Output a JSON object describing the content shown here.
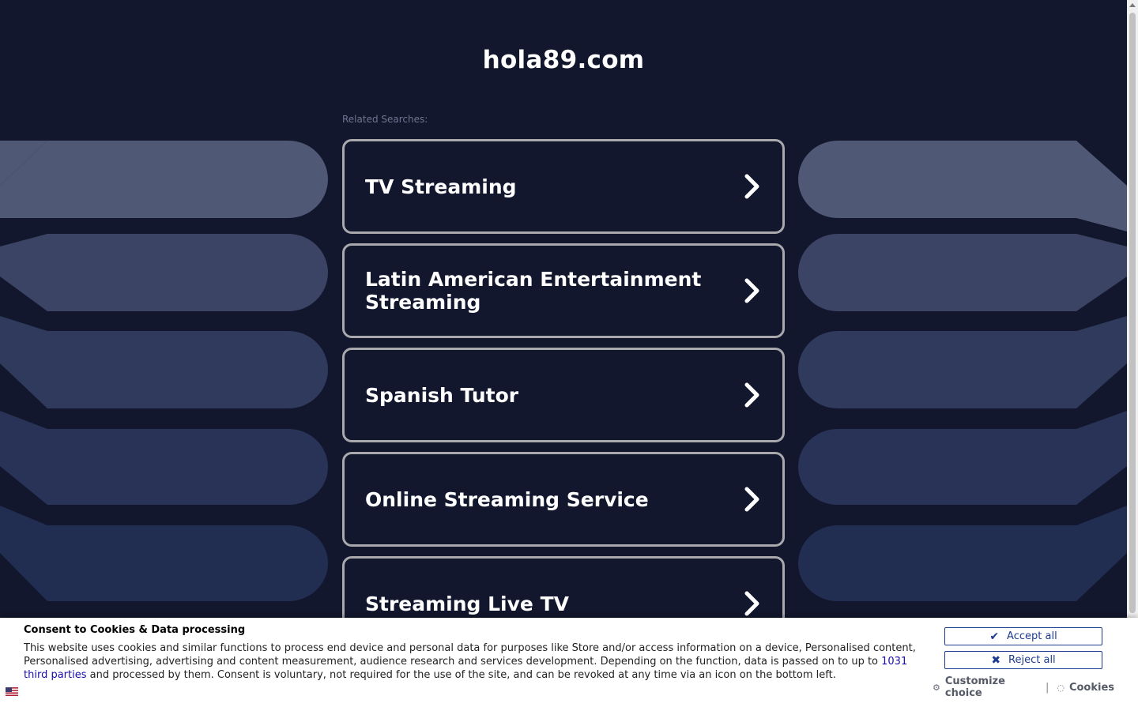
{
  "site": {
    "title": "hola89.com",
    "related_label": "Related Searches:"
  },
  "searches": [
    {
      "label": "TV Streaming"
    },
    {
      "label": "Latin American Entertainment Streaming"
    },
    {
      "label": "Spanish Tutor"
    },
    {
      "label": "Online Streaming Service"
    },
    {
      "label": "Streaming Live TV"
    }
  ],
  "consent": {
    "title": "Consent to Cookies & Data processing",
    "body_part1": "This website uses cookies and similar functions to process end device and personal data for purposes like Store and/or access information on a device, Personalised content, Personalised advertising, advertising and content measurement, audience research and services development. Depending on the function, data is passed on to up to ",
    "link_text": "1031 third parties",
    "body_part2": " and processed by them. Consent is voluntary, not required for the use of the site, and can be revoked at any time via an icon on the bottom left.",
    "accept_label": "Accept all",
    "reject_label": "Reject all",
    "customize_label": "Customize choice",
    "separator": "|",
    "cookies_label": "Cookies",
    "accept_icon": "check-icon",
    "reject_icon": "x-icon",
    "customize_icon": "gear-icon",
    "cookies_icon": "cookie-icon"
  },
  "colors": {
    "background": "#12172d",
    "card_border": "#a8a8ad",
    "button_accent": "#1d3b8f",
    "link": "#1a0dab"
  }
}
